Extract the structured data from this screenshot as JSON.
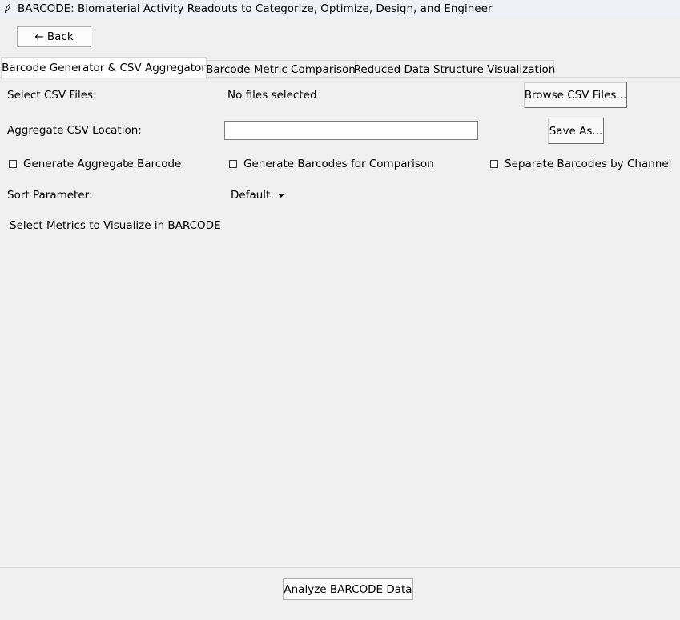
{
  "window": {
    "title": "BARCODE: Biomaterial Activity Readouts to Categorize, Optimize, Design, and Engineer",
    "icon": "feather-icon"
  },
  "nav": {
    "back_label": "← Back"
  },
  "tabs": [
    {
      "label": "Barcode Generator & CSV Aggregator",
      "active": true
    },
    {
      "label": "Barcode Metric Comparison",
      "active": false
    },
    {
      "label": "Reduced Data Structure Visualization",
      "active": false
    }
  ],
  "form": {
    "csv_files_label": "Select CSV Files:",
    "csv_files_status": "No files selected",
    "browse_label": "Browse CSV Files...",
    "aggregate_label": "Aggregate CSV Location:",
    "aggregate_value": "",
    "save_as_label": "Save As...",
    "checkboxes": [
      {
        "label": "Generate Aggregate Barcode",
        "checked": false
      },
      {
        "label": "Generate Barcodes for Comparison",
        "checked": false
      },
      {
        "label": "Separate Barcodes by Channel",
        "checked": false
      }
    ],
    "sort_label": "Sort Parameter:",
    "sort_value": "Default",
    "metrics_label": "Select Metrics to Visualize in BARCODE"
  },
  "footer": {
    "analyze_label": "Analyze BARCODE Data"
  }
}
